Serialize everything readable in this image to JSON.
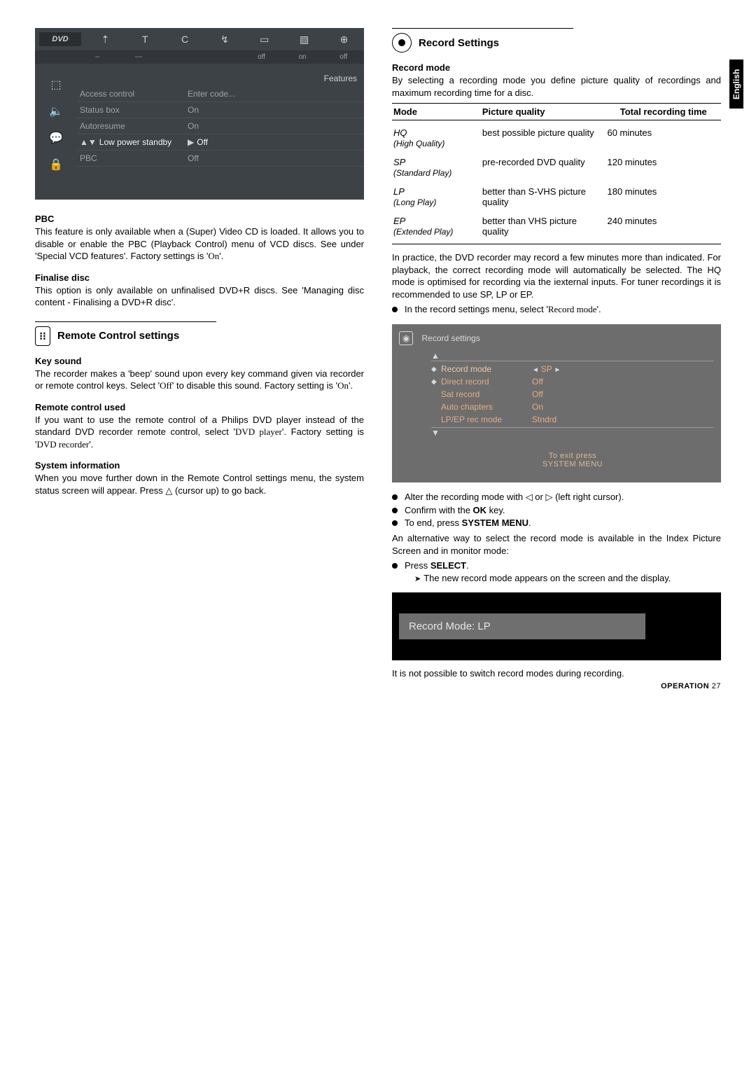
{
  "lang": "English",
  "osd_top": {
    "dvd": "DVD",
    "icons": [
      "⇡",
      "T",
      "C",
      "↯",
      "▭",
      "▧",
      "⊕"
    ],
    "vals": [
      "--",
      "---",
      "",
      "",
      "off",
      "on",
      "off"
    ]
  },
  "osd_left_icons": [
    "⬚",
    "🔈",
    "💬",
    "🔒"
  ],
  "osd_features": "Features",
  "osd_menu": [
    {
      "label": "Access control",
      "value": "Enter code..."
    },
    {
      "label": "Status box",
      "value": "On"
    },
    {
      "label": "Autoresume",
      "value": "On"
    },
    {
      "label": "Low power standby",
      "value": "Off",
      "hl": true
    },
    {
      "label": "PBC",
      "value": "Off"
    }
  ],
  "left": {
    "pbc_h": "PBC",
    "pbc_p": "This feature is only available when a (Super) Video CD is loaded. It allows you to disable or enable the PBC (Playback Control) menu of VCD discs. See under 'Special VCD features'. Factory settings is '",
    "pbc_ui": "On",
    "pbc_end": "'.",
    "fin_h": "Finalise disc",
    "fin_p": "This option is only available on unfinalised DVD+R discs. See 'Managing disc content - Finalising a DVD+R disc'.",
    "rc_title": "Remote Control settings",
    "ks_h": "Key sound",
    "ks_p1": "The recorder makes a 'beep' sound upon every key command given via recorder or remote control keys. Select '",
    "ks_ui1": "Off",
    "ks_mid": "' to disable this sound. Factory setting is '",
    "ks_ui2": "On",
    "ks_end": "'.",
    "rcu_h": "Remote control used",
    "rcu_p1": "If you want to use the remote control of a Philips DVD player instead of the standard DVD recorder remote control, select '",
    "rcu_ui1": "DVD player",
    "rcu_mid": "'. Factory setting is '",
    "rcu_ui2": "DVD recorder",
    "rcu_end": "'.",
    "sys_h": "System information",
    "sys_p": "When you move further down in the Remote Control settings menu, the system status screen will appear. Press △ (cursor up) to go back."
  },
  "right": {
    "rs_title": "Record Settings",
    "rm_h": "Record mode",
    "rm_p": "By selecting a recording mode you define picture quality of recordings and maximum recording time for a disc.",
    "th_mode": "Mode",
    "th_pq": "Picture quality",
    "th_time": "Total recording time",
    "rows": [
      {
        "m": "HQ",
        "s": "(High Quality)",
        "pq": "best possible picture quality",
        "t": "60 minutes"
      },
      {
        "m": "SP",
        "s": "(Standard Play)",
        "pq": "pre-recorded DVD quality",
        "t": "120 minutes"
      },
      {
        "m": "LP",
        "s": "(Long Play)",
        "pq": "better than S-VHS picture quality",
        "t": "180 minutes"
      },
      {
        "m": "EP",
        "s": "(Extended Play)",
        "pq": "better than VHS picture quality",
        "t": "240 minutes"
      }
    ],
    "prac": "In practice, the DVD recorder may record a few minutes more than indicated. For playback, the correct recording mode will automatically be selected. The HQ mode is optimised for recording via the iexternal inputs. For tuner recordings it is recommended to use SP, LP or EP.",
    "b1a": "In the record settings menu, select '",
    "b1ui": "Record mode",
    "b1b": "'.",
    "rs_osd": {
      "title": "Record settings",
      "items": [
        {
          "label": "Record mode",
          "value": "SP",
          "sel": true
        },
        {
          "label": "Direct record",
          "value": "Off"
        },
        {
          "label": "Sat record",
          "value": "Off"
        },
        {
          "label": "Auto chapters",
          "value": "On"
        },
        {
          "label": "LP/EP rec mode",
          "value": "Stndrd"
        }
      ],
      "exit1": "To exit press",
      "exit2": "SYSTEM MENU"
    },
    "b2": "Alter the recording mode with ◁ or ▷ (left right cursor).",
    "b3a": "Confirm with the ",
    "b3b": "OK",
    "b3c": " key.",
    "b4a": "To end, press ",
    "b4b": "SYSTEM MENU",
    "b4c": ".",
    "alt": "An alternative way to select the record mode is available in the Index Picture Screen and in monitor mode:",
    "b5a": "Press ",
    "b5b": "SELECT",
    "b5c": ".",
    "sub": "The new record mode appears on the screen and the display.",
    "rm_box": "Record Mode: LP",
    "notpos": "It is not possible to switch record modes during recording."
  },
  "footer": {
    "op": "OPERATION",
    "pg": "27"
  }
}
